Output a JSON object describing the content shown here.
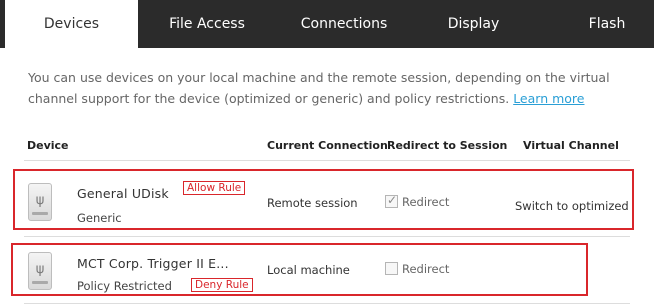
{
  "tabs": [
    {
      "label": "Devices",
      "active": true
    },
    {
      "label": "File Access",
      "active": false
    },
    {
      "label": "Connections",
      "active": false
    },
    {
      "label": "Display",
      "active": false
    },
    {
      "label": "Flash",
      "active": false
    }
  ],
  "intro": {
    "text": "You can use devices on your local machine and the remote session, depending on the virtual channel support for the device (optimized or generic) and policy restrictions.",
    "link_label": "Learn more"
  },
  "table": {
    "headers": {
      "device": "Device",
      "current_connection": "Current Connection",
      "redirect_to_session": "Redirect to Session",
      "virtual_channel": "Virtual Channel"
    },
    "rows": [
      {
        "name": "General  UDisk",
        "subtitle": "Generic",
        "connection": "Remote session",
        "redirect_label": "Redirect",
        "redirect_checked": true,
        "virtual_channel": "Switch to optimized",
        "rule_label": "Allow Rule",
        "icon": "usb-icon"
      },
      {
        "name": "MCT Corp. Trigger II E...",
        "subtitle": "Policy Restricted",
        "connection": "Local machine",
        "redirect_label": "Redirect",
        "redirect_checked": false,
        "virtual_channel": "",
        "rule_label": "Deny Rule",
        "icon": "usb-icon"
      }
    ]
  },
  "colors": {
    "tab_bar": "#2b2b2b",
    "annotation": "#d9262b",
    "link": "#2a9fd6"
  }
}
